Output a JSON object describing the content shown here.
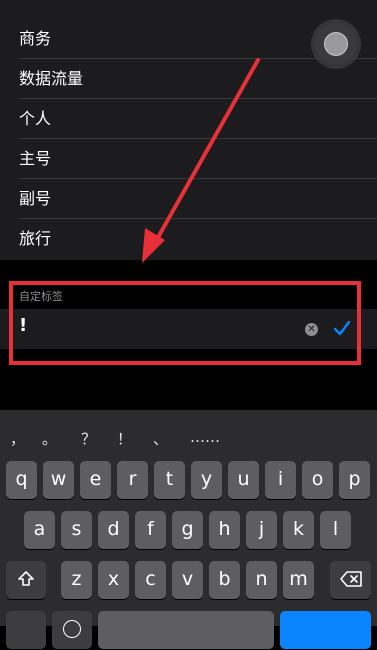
{
  "list": {
    "items": [
      {
        "label": "商务"
      },
      {
        "label": "数据流量"
      },
      {
        "label": "个人"
      },
      {
        "label": "主号"
      },
      {
        "label": "副号"
      },
      {
        "label": "旅行"
      }
    ]
  },
  "custom_label": {
    "header": "自定标签",
    "value": "!",
    "clear_icon": "clear-circle-icon",
    "confirm_icon": "checkmark-icon"
  },
  "colors": {
    "highlight": "#e8303a",
    "accent": "#0a84ff"
  },
  "keyboard": {
    "suggestions": [
      "，",
      "。",
      "？",
      "！",
      "、",
      "……"
    ],
    "row1": [
      "q",
      "w",
      "e",
      "r",
      "t",
      "y",
      "u",
      "i",
      "o",
      "p"
    ],
    "row2": [
      "a",
      "s",
      "d",
      "f",
      "g",
      "h",
      "j",
      "k",
      "l"
    ],
    "row3": [
      "z",
      "x",
      "c",
      "v",
      "b",
      "n",
      "m"
    ],
    "shift_icon": "shift-icon",
    "delete_icon": "delete-icon"
  }
}
